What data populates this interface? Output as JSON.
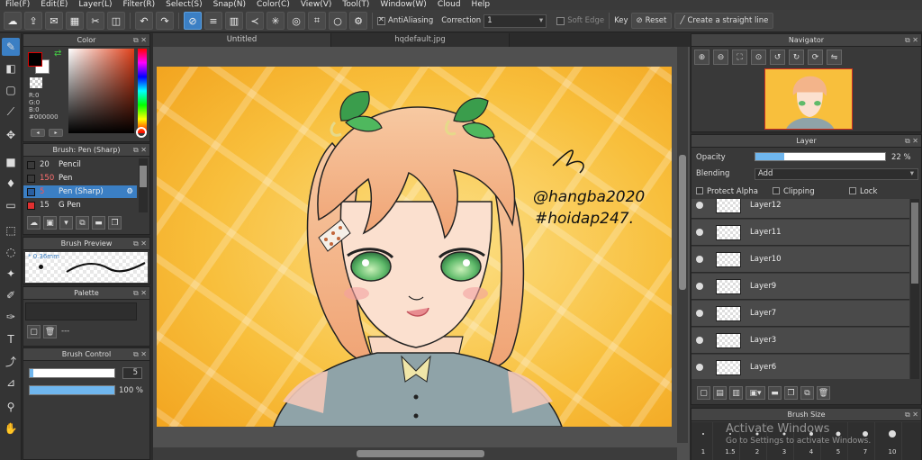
{
  "menubar": {
    "items": [
      "File(F)",
      "Edit(E)",
      "Layer(L)",
      "Filter(R)",
      "Select(S)",
      "Snap(N)",
      "Color(C)",
      "View(V)",
      "Tool(T)",
      "Window(W)",
      "Cloud",
      "Help"
    ]
  },
  "toolbar": {
    "antialiasing_label": "AntiAliasing",
    "correction_label": "Correction",
    "correction_value": "1",
    "soft_edge_label": "Soft Edge",
    "key_label": "Key",
    "reset_label": "Reset",
    "straight_line_label": "Create a straight line"
  },
  "color_panel": {
    "title": "Color",
    "r": "R:0",
    "g": "G:0",
    "b": "B:0",
    "hex": "#000000"
  },
  "brush_panel": {
    "title": "Brush: Pen (Sharp)",
    "items": [
      {
        "size": "20",
        "name": "Pencil",
        "swatch": "#3a3a3a"
      },
      {
        "size": "150",
        "name": "Pen",
        "swatch": "#3a3a3a"
      },
      {
        "size": "5",
        "name": "Pen (Sharp)",
        "swatch": "#2a5fa0"
      },
      {
        "size": "15",
        "name": "G Pen",
        "swatch": "#e03030"
      }
    ]
  },
  "brush_preview": {
    "title": "Brush Preview",
    "size_label": "* 0.36mm"
  },
  "palette_panel": {
    "title": "Palette",
    "field_value": "---"
  },
  "brush_control": {
    "title": "Brush Control",
    "size_value": "5",
    "size_fraction": 0.04,
    "opacity_value": "100 %",
    "opacity_fraction": 1.0
  },
  "document_tabs": [
    "Untitled",
    "hqdefault.jpg"
  ],
  "artwork": {
    "signature_line1": "@hangba2020",
    "signature_line2": "#hoidap247."
  },
  "navigator": {
    "title": "Navigator"
  },
  "layer_panel": {
    "title": "Layer",
    "opacity_label": "Opacity",
    "opacity_value": "22 %",
    "opacity_fraction": 0.22,
    "blending_label": "Blending",
    "blending_value": "Add",
    "protect_alpha_label": "Protect Alpha",
    "clipping_label": "Clipping",
    "lock_label": "Lock",
    "layers": [
      "Layer12",
      "Layer11",
      "Layer10",
      "Layer9",
      "Layer7",
      "Layer3",
      "Layer6"
    ]
  },
  "brush_size_panel": {
    "title": "Brush Size",
    "sizes": [
      "1",
      "1.5",
      "2",
      "3",
      "4",
      "5",
      "7",
      "10"
    ]
  },
  "windows_watermark": {
    "line1": "Activate Windows",
    "line2": "Go to Settings to activate Windows."
  },
  "colors": {
    "accent": "#3b7fc4",
    "background_orange": "#f7b531",
    "hair": "#f3b48a"
  }
}
